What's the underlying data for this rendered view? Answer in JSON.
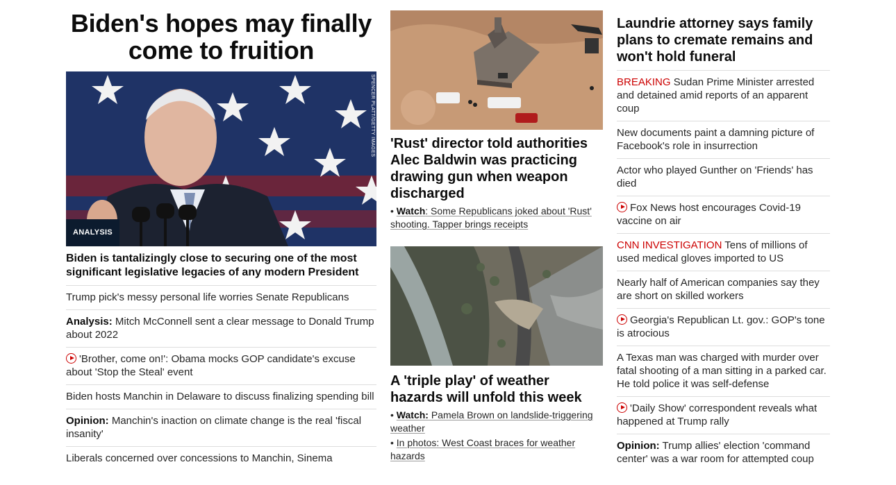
{
  "col1": {
    "hero_title": "Biden's hopes may finally come to fruition",
    "hero_image_credit": "SPENCER PLATT/GETTY IMAGES",
    "hero_badge": "ANALYSIS",
    "hero_sub": "Biden is tantalizingly close to securing one of the most significant legislative legacies of any modern President",
    "items": [
      {
        "label": "",
        "text": "Trump pick's messy personal life worries Senate Republicans",
        "video": false
      },
      {
        "label": "Analysis:",
        "text": " Mitch McConnell sent a clear message to Donald Trump about 2022",
        "video": false
      },
      {
        "label": "",
        "text": "'Brother, come on!': Obama mocks GOP candidate's excuse about 'Stop the Steal' event",
        "video": true
      },
      {
        "label": "",
        "text": "Biden hosts Manchin in Delaware to discuss finalizing spending bill",
        "video": false
      },
      {
        "label": "Opinion:",
        "text": " Manchin's inaction on climate change is the real 'fiscal insanity'",
        "video": false
      },
      {
        "label": "",
        "text": "Liberals concerned over concessions to Manchin, Sinema",
        "video": false
      }
    ]
  },
  "col2": {
    "story1": {
      "title": "'Rust' director told authorities Alec Baldwin was practicing drawing gun when weapon discharged",
      "bullets": [
        {
          "label": "Watch",
          "text": ": Some Republicans joked about 'Rust' shooting. Tapper brings receipts"
        }
      ]
    },
    "story2": {
      "title": "A 'triple play' of weather hazards will unfold this week",
      "bullets": [
        {
          "label": "Watch:",
          "text": " Pamela Brown on landslide-triggering weather"
        },
        {
          "label": "",
          "text": "In photos: West Coast braces for weather hazards"
        }
      ]
    }
  },
  "col3": {
    "title": "Laundrie attorney says family plans to cremate remains and won't hold funeral",
    "items": [
      {
        "red": "BREAKING",
        "text": " Sudan Prime Minister arrested and detained amid reports of an apparent coup",
        "video": false
      },
      {
        "red": "",
        "text": "New documents paint a damning picture of Facebook's role in insurrection",
        "video": false
      },
      {
        "red": "",
        "text": "Actor who played Gunther on 'Friends' has died",
        "video": false
      },
      {
        "red": "",
        "text": "Fox News host encourages Covid-19 vaccine on air",
        "video": true
      },
      {
        "red": "CNN INVESTIGATION",
        "text": " Tens of millions of used medical gloves imported to US",
        "video": false
      },
      {
        "red": "",
        "text": "Nearly half of American companies say they are short on skilled workers",
        "video": false
      },
      {
        "red": "",
        "text": "Georgia's Republican Lt. gov.: GOP's tone is atrocious",
        "video": true
      },
      {
        "red": "",
        "text": "A Texas man was charged with murder over fatal shooting of a man sitting in a parked car. He told police it was self-defense",
        "video": false
      },
      {
        "red": "",
        "text": "'Daily Show' correspondent reveals what happened at Trump rally",
        "video": true
      },
      {
        "red": "",
        "bold": "Opinion:",
        "text": " Trump allies' election 'command center' was a war room for attempted coup",
        "video": false
      }
    ]
  },
  "colors": {
    "accent_red": "#cc0000",
    "badge_bg": "#0c1b2e",
    "divider": "#dddddd"
  }
}
